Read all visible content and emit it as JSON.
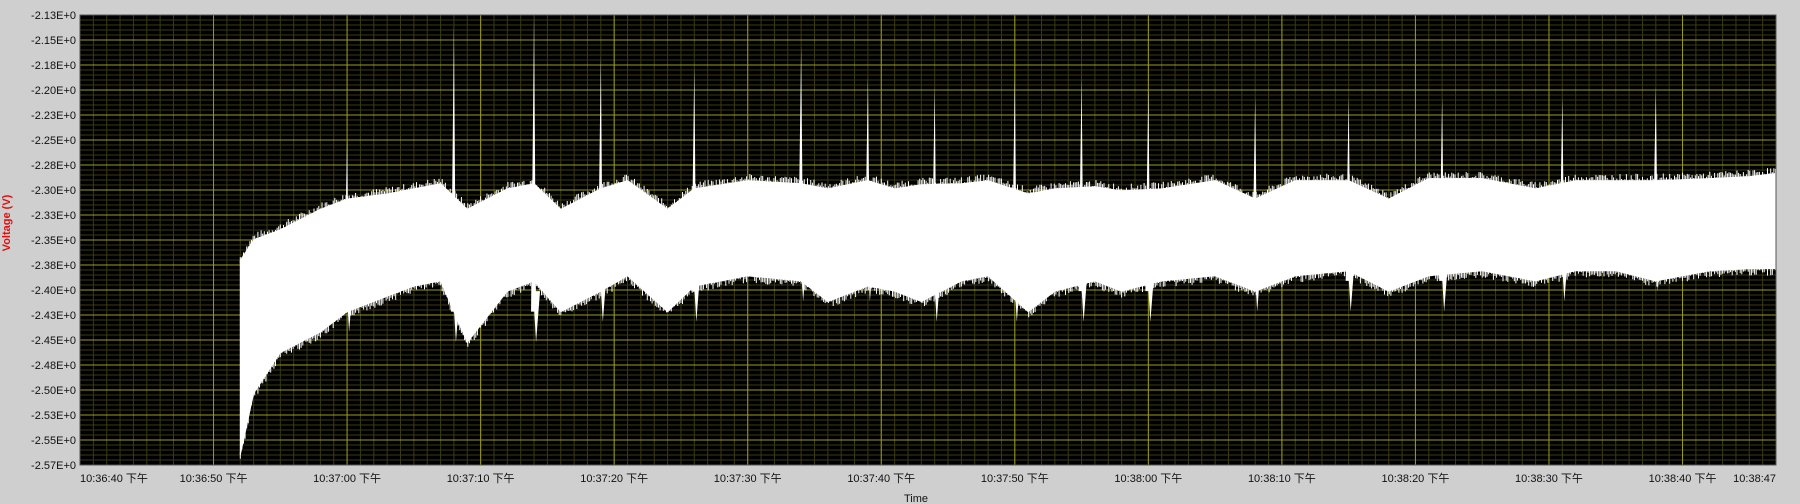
{
  "chart_data": {
    "type": "line",
    "title": "",
    "xlabel": "Time",
    "ylabel": "Voltage (V)",
    "xlim": [
      "10:36:40",
      "10:38:47"
    ],
    "ylim": [
      -2.57,
      -2.13
    ],
    "x_ticks": [
      "10:36:40 下午",
      "10:36:50 下午",
      "10:37:00 下午",
      "10:37:10 下午",
      "10:37:20 下午",
      "10:37:30 下午",
      "10:37:40 下午",
      "10:37:50 下午",
      "10:38:00 下午",
      "10:38:10 下午",
      "10:38:20 下午",
      "10:38:30 下午",
      "10:38:40 下午",
      "10:38:47"
    ],
    "y_ticks": [
      "-2.13E+0",
      "-2.15E+0",
      "-2.18E+0",
      "-2.20E+0",
      "-2.23E+0",
      "-2.25E+0",
      "-2.28E+0",
      "-2.30E+0",
      "-2.33E+0",
      "-2.35E+0",
      "-2.38E+0",
      "-2.40E+0",
      "-2.43E+0",
      "-2.45E+0",
      "-2.48E+0",
      "-2.50E+0",
      "-2.53E+0",
      "-2.55E+0",
      "-2.57E+0"
    ],
    "grid": true,
    "colors": {
      "plot_background": "#000000",
      "major_grid": "#9a9a20",
      "minor_grid": "#3a3a12",
      "trace": "#ffffff",
      "ylabel": "#e01010"
    },
    "series": [
      {
        "band_upper": {
          "x": [
            "10:36:52",
            "10:36:53",
            "10:36:55",
            "10:36:58",
            "10:37:00",
            "10:37:03",
            "10:37:05",
            "10:37:07",
            "10:37:09",
            "10:37:12",
            "10:37:14",
            "10:37:16",
            "10:37:19",
            "10:37:21",
            "10:37:24",
            "10:37:26",
            "10:37:30",
            "10:37:34",
            "10:37:36",
            "10:37:39",
            "10:37:41",
            "10:37:43",
            "10:37:46",
            "10:37:48",
            "10:37:51",
            "10:37:53",
            "10:37:56",
            "10:37:58",
            "10:38:01",
            "10:38:05",
            "10:38:08",
            "10:38:11",
            "10:38:15",
            "10:38:18",
            "10:38:21",
            "10:38:25",
            "10:38:29",
            "10:38:32",
            "10:38:35",
            "10:38:38",
            "10:38:42",
            "10:38:45",
            "10:38:47"
          ],
          "y": [
            -2.37,
            -2.35,
            -2.34,
            -2.32,
            -2.31,
            -2.305,
            -2.3,
            -2.295,
            -2.32,
            -2.3,
            -2.295,
            -2.32,
            -2.3,
            -2.292,
            -2.32,
            -2.3,
            -2.292,
            -2.295,
            -2.3,
            -2.292,
            -2.3,
            -2.296,
            -2.295,
            -2.292,
            -2.305,
            -2.3,
            -2.298,
            -2.302,
            -2.3,
            -2.292,
            -2.31,
            -2.292,
            -2.292,
            -2.31,
            -2.29,
            -2.29,
            -2.3,
            -2.292,
            -2.292,
            -2.292,
            -2.29,
            -2.288,
            -2.285
          ]
        },
        "band_lower": {
          "x": [
            "10:36:52",
            "10:36:53",
            "10:36:55",
            "10:36:58",
            "10:37:00",
            "10:37:03",
            "10:37:05",
            "10:37:07",
            "10:37:09",
            "10:37:12",
            "10:37:14",
            "10:37:16",
            "10:37:19",
            "10:37:21",
            "10:37:24",
            "10:37:26",
            "10:37:30",
            "10:37:34",
            "10:37:36",
            "10:37:39",
            "10:37:41",
            "10:37:43",
            "10:37:46",
            "10:37:48",
            "10:37:51",
            "10:37:53",
            "10:37:56",
            "10:37:58",
            "10:38:01",
            "10:38:05",
            "10:38:08",
            "10:38:11",
            "10:38:15",
            "10:38:18",
            "10:38:21",
            "10:38:25",
            "10:38:29",
            "10:38:32",
            "10:38:35",
            "10:38:38",
            "10:38:42",
            "10:38:45",
            "10:38:47"
          ],
          "y": [
            -2.56,
            -2.5,
            -2.46,
            -2.44,
            -2.42,
            -2.405,
            -2.395,
            -2.39,
            -2.45,
            -2.4,
            -2.39,
            -2.42,
            -2.4,
            -2.385,
            -2.42,
            -2.395,
            -2.385,
            -2.39,
            -2.41,
            -2.395,
            -2.4,
            -2.41,
            -2.39,
            -2.385,
            -2.42,
            -2.4,
            -2.39,
            -2.4,
            -2.39,
            -2.385,
            -2.4,
            -2.385,
            -2.38,
            -2.4,
            -2.385,
            -2.38,
            -2.39,
            -2.38,
            -2.38,
            -2.39,
            -2.38,
            -2.378,
            -2.378
          ]
        },
        "spikes": [
          {
            "t": "10:37:00",
            "top": -2.25,
            "bottom": -2.44
          },
          {
            "t": "10:37:08",
            "top": -2.14,
            "bottom": -2.45
          },
          {
            "t": "10:37:14",
            "top": -2.13,
            "bottom": -2.45
          },
          {
            "t": "10:37:19",
            "top": -2.17,
            "bottom": -2.43
          },
          {
            "t": "10:37:26",
            "top": -2.18,
            "bottom": -2.43
          },
          {
            "t": "10:37:34",
            "top": -2.16,
            "bottom": -2.41
          },
          {
            "t": "10:37:39",
            "top": -2.19,
            "bottom": -2.41
          },
          {
            "t": "10:37:44",
            "top": -2.2,
            "bottom": -2.43
          },
          {
            "t": "10:37:50",
            "top": -2.19,
            "bottom": -2.43
          },
          {
            "t": "10:37:55",
            "top": -2.19,
            "bottom": -2.43
          },
          {
            "t": "10:38:00",
            "top": -2.2,
            "bottom": -2.43
          },
          {
            "t": "10:38:08",
            "top": -2.21,
            "bottom": -2.42
          },
          {
            "t": "10:38:15",
            "top": -2.21,
            "bottom": -2.42
          },
          {
            "t": "10:38:22",
            "top": -2.21,
            "bottom": -2.42
          },
          {
            "t": "10:38:31",
            "top": -2.21,
            "bottom": -2.41
          },
          {
            "t": "10:38:38",
            "top": -2.2,
            "bottom": -2.4
          }
        ]
      }
    ]
  }
}
